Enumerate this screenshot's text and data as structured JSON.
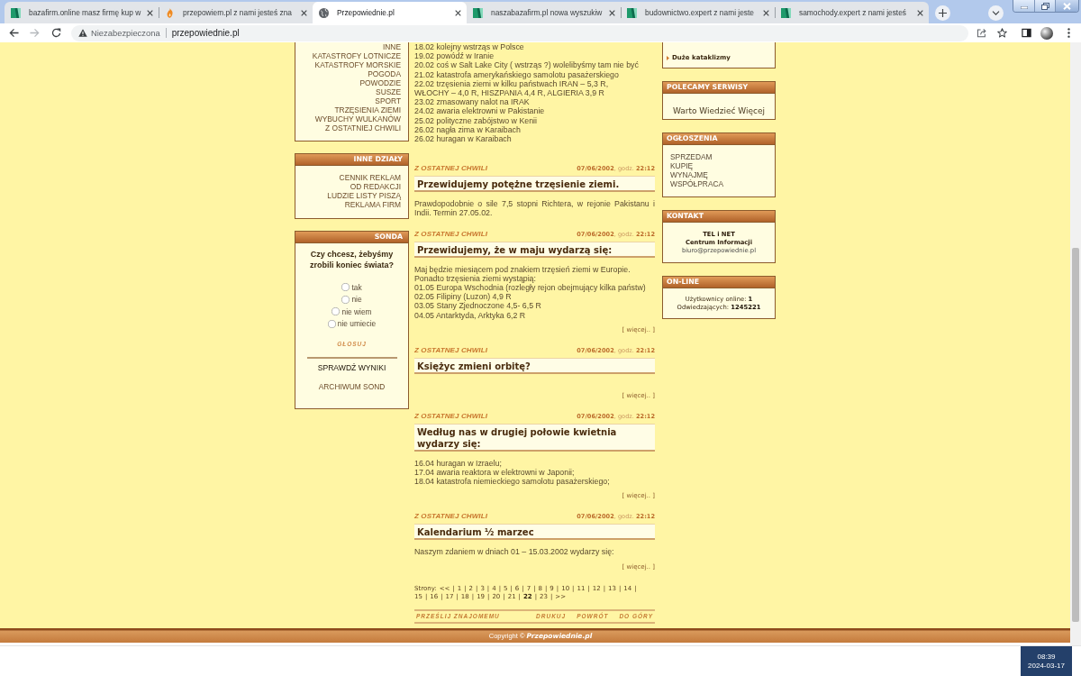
{
  "browser": {
    "tabs": [
      {
        "title": "bazafirm.online masz firmę kup w",
        "kind": "tiles",
        "selected": false
      },
      {
        "title": "przepowiem.pl z nami jesteś zna",
        "kind": "flame",
        "selected": false
      },
      {
        "title": "Przepowiednie.pl",
        "kind": "globe",
        "selected": true
      },
      {
        "title": "naszabazafirm.pl nowa wyszukiw",
        "kind": "tiles",
        "selected": false
      },
      {
        "title": "budownictwo.expert z nami jeste",
        "kind": "tiles",
        "selected": false
      },
      {
        "title": "samochody.expert z nami jesteś",
        "kind": "tiles",
        "selected": false
      }
    ],
    "address_bar": {
      "security_label": "Niezabezpieczona",
      "url": "przepowiednie.pl"
    }
  },
  "left_column": {
    "categories": [
      "INNE",
      "KATASTROFY LOTNICZE",
      "KATASTROFY MORSKIE",
      "POGODA",
      "POWODZIE",
      "SUSZE",
      "SPORT",
      "TRZĘSIENIA ZIEMI",
      "WYBUCHY WULKANÓW",
      "Z OSTATNIEJ CHWILI"
    ],
    "other_sections": {
      "title": "INNE DZIAŁY",
      "items": [
        "CENNIK REKLAM",
        "OD REDAKCJI",
        "LUDZIE LISTY PISZĄ",
        "REKLAMA FIRM"
      ]
    },
    "poll": {
      "title": "SONDA",
      "question": "Czy chcesz, żebyśmy zrobili koniec świata?",
      "options": [
        {
          "label": "tak",
          "selected": false
        },
        {
          "label": "nie",
          "selected": false
        },
        {
          "label": "nie wiem",
          "selected": false
        },
        {
          "label": "nie umiecie",
          "selected": false
        }
      ],
      "vote": "GŁOSUJ",
      "results": "SPRAWDŹ WYNIKI",
      "archive": "ARCHIWUM SOND"
    }
  },
  "main": {
    "intro_lines": [
      "18.02 kolejny wstrząs w Polsce",
      "19.02 powódź w Iranie",
      "20.02 coś w Salt Lake City ( wstrząs ?) wolelibyśmy tam nie być",
      "21.02 katastrofa amerykańskiego samolotu pasażerskiego",
      "22.02 trzęsienia ziemi w kilku państwach IRAN – 5,3 R,",
      "WŁOCHY – 4,0 R, HISZPANIA 4,4 R, ALGIERIA 3,9 R",
      "23.02 zmasowany nalot na IRAK",
      "24.02 awaria elektrowni w Pakistanie",
      "25.02 polityczne zabójstwo w Kenii",
      "26.02 nagła zima w Karaibach",
      "26.02 huragan w Karaibach"
    ],
    "articles": [
      {
        "category": "Z OSTATNEJ CHWILI",
        "date": "**07/06/2002**, godz. **22:12**",
        "title": "Przewidujemy potężne trzęsienie ziemi.",
        "body": [
          "Prawdopodobnie o sile 7,5 stopni Richtera, w rejonie Pakistanu i Indii. Termin 27.05.02."
        ]
      },
      {
        "category": "Z OSTATNEJ CHWILI",
        "date": "**07/06/2002**, godz. **22:12**",
        "title": "Przewidujemy, że w maju wydarzą się:",
        "body": [
          "Maj będzie miesiącem pod znakiem trzęsień ziemi w Europie.",
          "Ponadto trzęsienia ziemi wystąpią:",
          "01.05 Europa Wschodnia (rozległy rejon obejmujący kilka państw)",
          "02.05 Filipiny (Luzon) 4,9 R",
          "03.05 Stany Zjednoczone 4,5- 6,5 R",
          "04.05 Antarktyda, Arktyka 6,2 R"
        ],
        "more": "[ więcej.. ]"
      },
      {
        "category": "Z OSTATNEJ CHWILI",
        "date": "**07/06/2002**, godz. **22:12**",
        "title": "Księżyc zmieni orbitę?",
        "more": "[ więcej.. ]"
      },
      {
        "category": "Z OSTATNEJ CHWILI",
        "date": "**07/06/2002**, godz. **22:12**",
        "title": "Według nas w drugiej połowie kwietnia wydarzy się:",
        "body": [
          "16.04 huragan w Izraelu;",
          "17.04 awaria reaktora w elektrowni w Japonii;",
          "18.04 katastrofa niemieckiego samolotu pasażerskiego;"
        ],
        "more": "[ więcej.. ]"
      },
      {
        "category": "Z OSTATNEJ CHWILI",
        "date": "**07/06/2002**, godz. **22:12**",
        "title": "Kalendarium ½ marzec",
        "body": [
          "Naszym zdaniem w dniach 01 – 15.03.2002 wydarzy się:"
        ],
        "more": "[ więcej.. ]"
      }
    ],
    "pagination": {
      "label": "Strony:",
      "separator": "|",
      "pages": [
        {
          "label": "<<",
          "selected": false
        },
        {
          "label": "1",
          "selected": false
        },
        {
          "label": "2",
          "selected": false
        },
        {
          "label": "3",
          "selected": false
        },
        {
          "label": "4",
          "selected": false
        },
        {
          "label": "5",
          "selected": false
        },
        {
          "label": "6",
          "selected": false
        },
        {
          "label": "7",
          "selected": false
        },
        {
          "label": "8",
          "selected": false
        },
        {
          "label": "9",
          "selected": false
        },
        {
          "label": "10",
          "selected": false
        },
        {
          "label": "11",
          "selected": false
        },
        {
          "label": "12",
          "selected": false
        },
        {
          "label": "13",
          "selected": false
        },
        {
          "label": "14",
          "selected": false
        },
        {
          "label": "15",
          "selected": false
        },
        {
          "label": "16",
          "selected": false
        },
        {
          "label": "17",
          "selected": false
        },
        {
          "label": "18",
          "selected": false
        },
        {
          "label": "19",
          "selected": false
        },
        {
          "label": "20",
          "selected": false
        },
        {
          "label": "21",
          "selected": false
        },
        {
          "label": "22",
          "selected": true
        },
        {
          "label": "23",
          "selected": false
        },
        {
          "label": ">>",
          "selected": false
        }
      ]
    },
    "actions": {
      "left": [
        "PRZEŚLIJ ZNAJOMEMU"
      ],
      "right": [
        "DRUKUJ",
        "POWRÓT",
        "DO GÓRY"
      ]
    }
  },
  "right_column": {
    "links_box": {
      "items": [
        "Duże kataklizmy"
      ]
    },
    "recommended": {
      "title": "POLECAMY SERWISY",
      "items": [
        "Warto Wiedzieć Więcej"
      ]
    },
    "ads": {
      "title": "OGŁOSZENIA",
      "items": [
        "SPRZEDAM",
        "KUPIĘ",
        "WYNAJMĘ",
        "WSPÓŁPRACA"
      ]
    },
    "contact": {
      "title": "KONTAKT",
      "name": "TEL i NET",
      "subtitle": "Centrum Informacji",
      "email": "biuro@przepowiednie.pl"
    },
    "online": {
      "title": "ON-LINE",
      "lines": [
        "Użytkownicy online: **1**",
        "Odwiedzających: **1245221**"
      ]
    }
  },
  "footer": {
    "copyright": "Copyright © **Przepowiednie.pl**"
  },
  "taskbar": {
    "time": "08:39",
    "date": "2024-03-17"
  }
}
